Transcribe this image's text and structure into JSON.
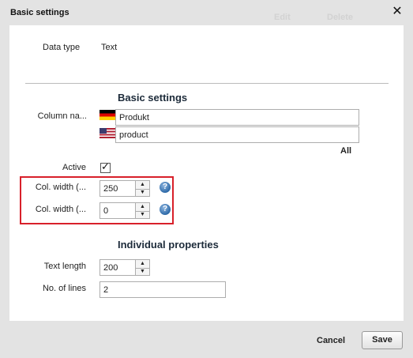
{
  "dialog": {
    "title": "Basic settings",
    "background_edit": "Edit",
    "background_delete": "Delete",
    "close_icon": "close-icon"
  },
  "info": {
    "data_type_label": "Data type",
    "data_type_value": "Text"
  },
  "basic_settings": {
    "heading": "Basic settings",
    "column_name_label": "Column na...",
    "column_name_de": "Produkt",
    "column_name_en": "product",
    "all_link": "All",
    "active_label": "Active",
    "active_checked": true,
    "col_width_1_label": "Col. width (...",
    "col_width_1_value": "250",
    "col_width_2_label": "Col. width (...",
    "col_width_2_value": "0",
    "help_icon": "help-icon",
    "highlight_color": "#d8202a"
  },
  "individual_properties": {
    "heading": "Individual properties",
    "text_length_label": "Text length",
    "text_length_value": "200",
    "no_of_lines_label": "No. of lines",
    "no_of_lines_value": "2"
  },
  "footer": {
    "cancel_label": "Cancel",
    "save_label": "Save"
  }
}
